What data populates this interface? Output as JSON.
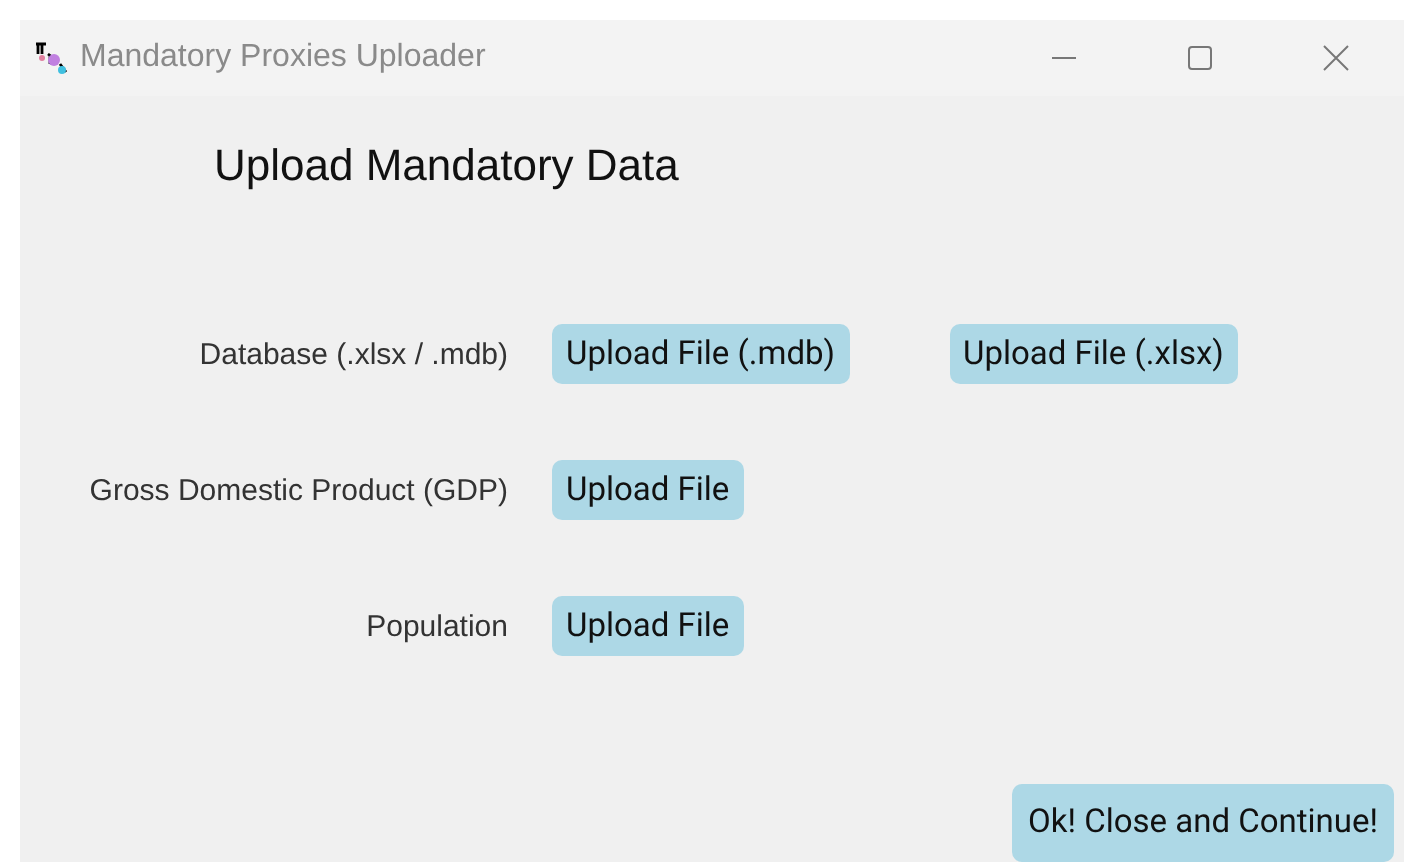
{
  "window": {
    "title": "Mandatory Proxies Uploader"
  },
  "heading": "Upload Mandatory Data",
  "rows": [
    {
      "label": "Database (.xlsx / .mdb)",
      "buttons": [
        "Upload File (.mdb)",
        "Upload File (.xlsx)"
      ]
    },
    {
      "label": "Gross Domestic Product (GDP)",
      "buttons": [
        "Upload File"
      ]
    },
    {
      "label": "Population",
      "buttons": [
        "Upload File"
      ]
    }
  ],
  "continue_button": "Ok! Close and Continue!"
}
